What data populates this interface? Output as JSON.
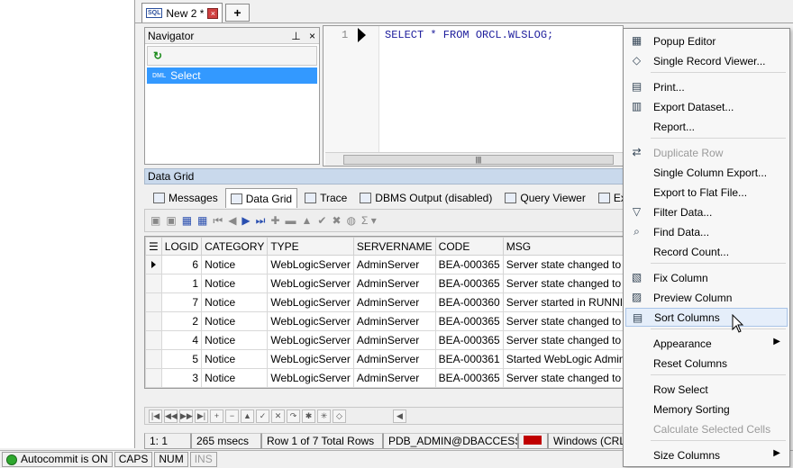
{
  "tabs": {
    "doc_tab": "New 2 *",
    "sql_badge": "SQL",
    "close_glyph": "×",
    "new_tab_glyph": "+"
  },
  "navigator": {
    "title": "Navigator",
    "pin_glyph": "⊥",
    "close_glyph": "×",
    "refresh_glyph": "↻",
    "dml_badge": "DML",
    "selected_item": "Select"
  },
  "editor": {
    "line_number": "1",
    "code": "SELECT * FROM ORCL.WLSLOG;",
    "scroll_glyph": "|||"
  },
  "results": {
    "section_title": "Data Grid",
    "tabs": [
      {
        "label": "Messages",
        "active": false
      },
      {
        "label": "Data Grid",
        "active": true
      },
      {
        "label": "Trace",
        "active": false
      },
      {
        "label": "DBMS Output (disabled)",
        "active": false
      },
      {
        "label": "Query Viewer",
        "active": false
      },
      {
        "label": "Explain Plan",
        "active": false
      }
    ]
  },
  "grid": {
    "columns": [
      "LOGID",
      "CATEGORY",
      "TYPE",
      "SERVERNAME",
      "CODE",
      "MSG"
    ],
    "rows": [
      [
        "6",
        "Notice",
        "WebLogicServer",
        "AdminServer",
        "BEA-000365",
        "Server state changed to"
      ],
      [
        "1",
        "Notice",
        "WebLogicServer",
        "AdminServer",
        "BEA-000365",
        "Server state changed to"
      ],
      [
        "7",
        "Notice",
        "WebLogicServer",
        "AdminServer",
        "BEA-000360",
        "Server started in RUNNIN"
      ],
      [
        "2",
        "Notice",
        "WebLogicServer",
        "AdminServer",
        "BEA-000365",
        "Server state changed to"
      ],
      [
        "4",
        "Notice",
        "WebLogicServer",
        "AdminServer",
        "BEA-000365",
        "Server state changed to"
      ],
      [
        "5",
        "Notice",
        "WebLogicServer",
        "AdminServer",
        "BEA-000361",
        "Started WebLogic Admin"
      ],
      [
        "3",
        "Notice",
        "WebLogicServer",
        "AdminServer",
        "BEA-000365",
        "Server state changed to"
      ]
    ],
    "current_row": 0
  },
  "status": {
    "position": "1:  1",
    "time": "265 msecs",
    "rows": "Row 1 of 7 Total Rows",
    "connection": "PDB_ADMIN@DBACCESS",
    "line_endings": "Windows (CRLF"
  },
  "bottom_bar": {
    "autocommit": "Autocommit is ON",
    "caps": "CAPS",
    "num": "NUM",
    "ins": "INS"
  },
  "context_menu": {
    "items": [
      {
        "label": "Popup Editor",
        "icon": "grid-icon",
        "disabled": false
      },
      {
        "label": "Single Record Viewer...",
        "icon": "record-icon",
        "disabled": false
      },
      {
        "label": "Print...",
        "icon": "printer-icon",
        "disabled": false
      },
      {
        "label": "Export Dataset...",
        "icon": "export-icon",
        "disabled": false
      },
      {
        "label": "Report...",
        "icon": "",
        "disabled": false
      },
      {
        "label": "Duplicate Row",
        "icon": "duplicate-icon",
        "disabled": true
      },
      {
        "label": "Single Column Export...",
        "icon": "",
        "disabled": false
      },
      {
        "label": "Export to Flat File...",
        "icon": "",
        "disabled": false
      },
      {
        "label": "Filter Data...",
        "icon": "filter-icon",
        "disabled": false
      },
      {
        "label": "Find Data...",
        "icon": "find-icon",
        "disabled": false
      },
      {
        "label": "Record Count...",
        "icon": "",
        "disabled": false
      },
      {
        "label": "Fix Column",
        "icon": "fix-column-icon",
        "disabled": false
      },
      {
        "label": "Preview Column",
        "icon": "preview-icon",
        "disabled": false
      },
      {
        "label": "Sort Columns",
        "icon": "sort-icon",
        "disabled": false,
        "highlighted": true
      },
      {
        "label": "Appearance",
        "icon": "",
        "disabled": false,
        "submenu": true
      },
      {
        "label": "Reset Columns",
        "icon": "",
        "disabled": false
      },
      {
        "label": "Row Select",
        "icon": "",
        "disabled": false
      },
      {
        "label": "Memory Sorting",
        "icon": "",
        "disabled": false
      },
      {
        "label": "Calculate Selected Cells",
        "icon": "",
        "disabled": true
      },
      {
        "label": "Size Columns",
        "icon": "",
        "disabled": false,
        "submenu": true
      }
    ],
    "submenu_glyph": "▶"
  }
}
